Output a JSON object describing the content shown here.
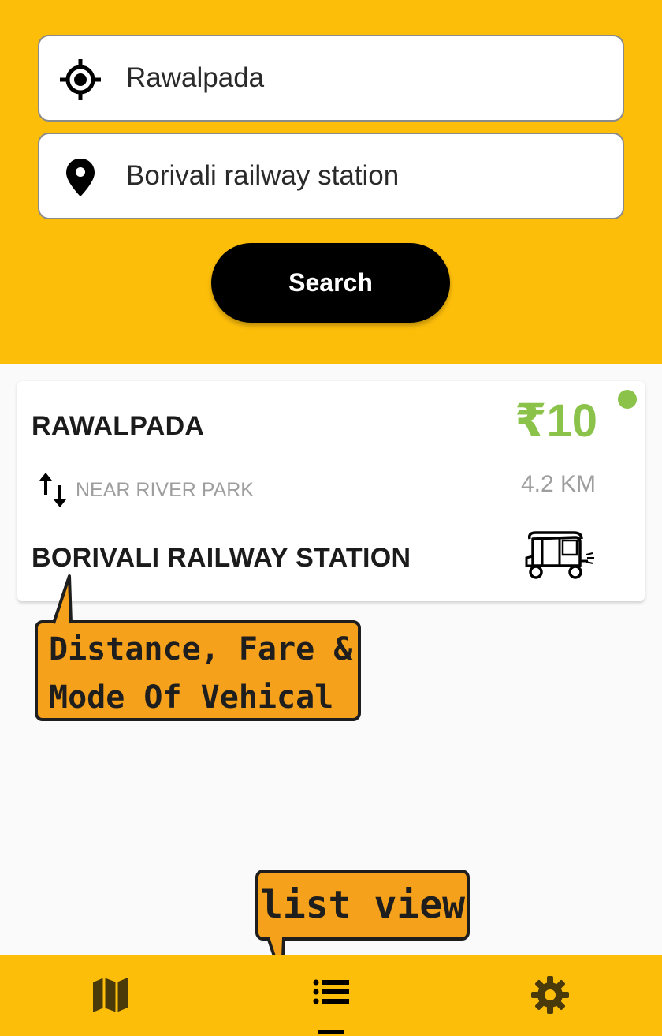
{
  "search": {
    "from_value": "Rawalpada",
    "to_value": "Borivali railway station",
    "button_label": "Search"
  },
  "route": {
    "origin": "RAWALPADA",
    "fare": "₹10",
    "via": "NEAR RIVER PARK",
    "distance": "4.2 KM",
    "destination": "BORIVALI RAILWAY STATION",
    "vehicle_icon": "auto-rickshaw-icon",
    "status_color": "#8bc34a"
  },
  "callouts": {
    "info_line1": "Distance, Fare &",
    "info_line2": "Mode Of Vehical",
    "list_view": "list view"
  },
  "nav": {
    "items": [
      {
        "icon": "map-icon"
      },
      {
        "icon": "list-icon",
        "active": true
      },
      {
        "icon": "gear-icon"
      }
    ]
  },
  "colors": {
    "accent": "#fdbe0a",
    "fare_green": "#8bc34a",
    "callout": "#f5a11b"
  }
}
